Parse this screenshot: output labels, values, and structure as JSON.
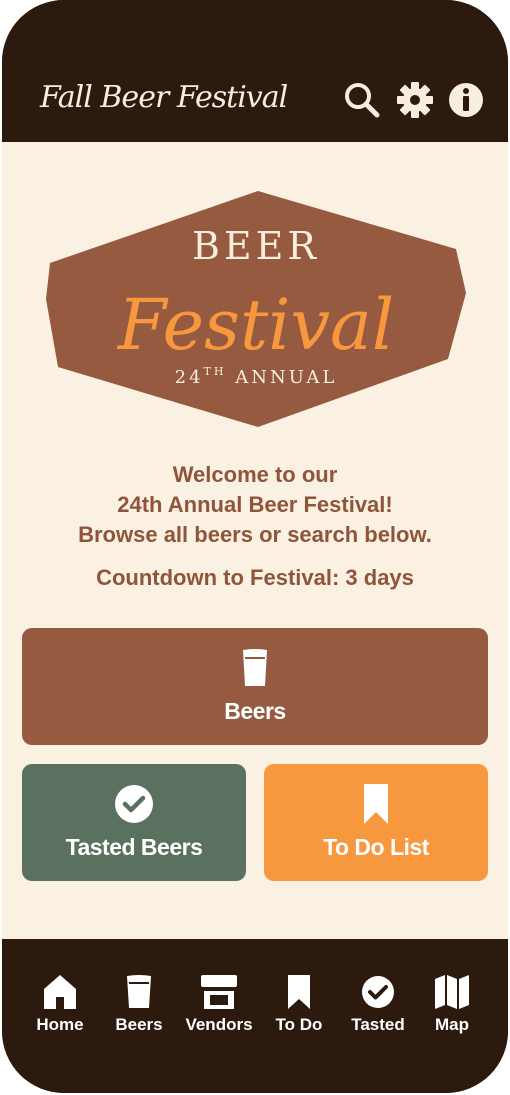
{
  "header": {
    "title": "Fall Beer Festival",
    "icons": [
      "search-icon",
      "gear-icon",
      "info-icon"
    ]
  },
  "hero": {
    "line1": "BEER",
    "line2": "Festival",
    "ordinal": "24",
    "ordinal_suffix": "TH",
    "line3": "ANNUAL"
  },
  "welcome": {
    "line1": "Welcome to our",
    "line2": "24th Annual Beer Festival!",
    "line3": "Browse all beers or search below."
  },
  "countdown": "Countdown to Festival: 3 days",
  "tiles": {
    "beers": "Beers",
    "tasted": "Tasted Beers",
    "todo": "To Do List"
  },
  "nav": {
    "items": [
      {
        "label": "Home",
        "icon": "home-icon"
      },
      {
        "label": "Beers",
        "icon": "beer-glass-icon"
      },
      {
        "label": "Vendors",
        "icon": "store-icon"
      },
      {
        "label": "To Do",
        "icon": "bookmark-icon"
      },
      {
        "label": "Tasted",
        "icon": "check-circle-icon"
      },
      {
        "label": "Map",
        "icon": "map-icon"
      }
    ]
  },
  "colors": {
    "dark_brown": "#2d1a0e",
    "cream": "#faf1e2",
    "brown": "#955a40",
    "green": "#5b7160",
    "orange": "#f7983e"
  }
}
